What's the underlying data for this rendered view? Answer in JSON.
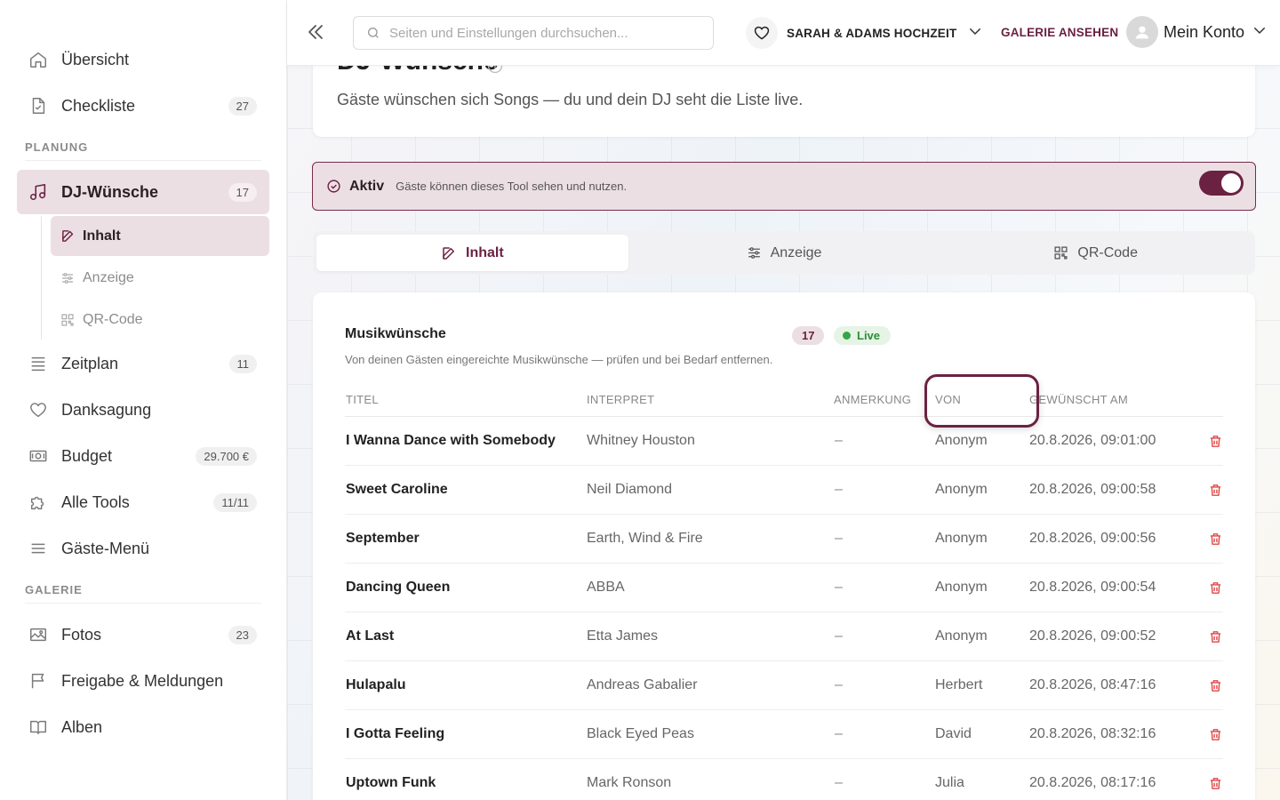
{
  "sidebar": {
    "top_items": [
      {
        "label": "Übersicht",
        "badge": ""
      },
      {
        "label": "Checkliste",
        "badge": "27"
      }
    ],
    "section_planung": "PLANUNG",
    "dj_item": {
      "label": "DJ-Wünsche",
      "badge": "17"
    },
    "dj_sub": [
      {
        "label": "Inhalt"
      },
      {
        "label": "Anzeige"
      },
      {
        "label": "QR-Code"
      }
    ],
    "planung_items": [
      {
        "label": "Zeitplan",
        "badge": "11"
      },
      {
        "label": "Danksagung",
        "badge": ""
      },
      {
        "label": "Budget",
        "badge": "29.700 €"
      },
      {
        "label": "Alle Tools",
        "badge": "11/11"
      },
      {
        "label": "Gäste-Menü",
        "badge": ""
      }
    ],
    "section_galerie": "GALERIE",
    "galerie_items": [
      {
        "label": "Fotos",
        "badge": "23"
      },
      {
        "label": "Freigabe & Meldungen",
        "badge": ""
      },
      {
        "label": "Alben",
        "badge": ""
      }
    ]
  },
  "topbar": {
    "search_placeholder": "Seiten und Einstellungen durchsuchen...",
    "event_name": "SARAH & ADAMS HOCHZEIT",
    "gallery_link": "GALERIE ANSEHEN",
    "account_label": "Mein Konto"
  },
  "header": {
    "title": "DJ-Wünsche",
    "subtitle": "Gäste wünschen sich Songs — du und dein DJ seht die Liste live."
  },
  "active_bar": {
    "label": "Aktiv",
    "hint": "Gäste können dieses Tool sehen und nutzen.",
    "toggle_on": true
  },
  "tabs": [
    {
      "label": "Inhalt",
      "active": true
    },
    {
      "label": "Anzeige",
      "active": false
    },
    {
      "label": "QR-Code",
      "active": false
    }
  ],
  "table": {
    "title": "Musikwünsche",
    "count": "17",
    "live_label": "Live",
    "description": "Von deinen Gästen eingereichte Musikwünsche — prüfen und bei Bedarf entfernen.",
    "columns": [
      "TITEL",
      "INTERPRET",
      "ANMERKUNG",
      "VON",
      "GEWÜNSCHT AM"
    ],
    "rows": [
      {
        "title": "I Wanna Dance with Somebody",
        "artist": "Whitney Houston",
        "note": "–",
        "from": "Anonym",
        "date": "20.8.2026, 09:01:00"
      },
      {
        "title": "Sweet Caroline",
        "artist": "Neil Diamond",
        "note": "–",
        "from": "Anonym",
        "date": "20.8.2026, 09:00:58"
      },
      {
        "title": "September",
        "artist": "Earth, Wind & Fire",
        "note": "–",
        "from": "Anonym",
        "date": "20.8.2026, 09:00:56"
      },
      {
        "title": "Dancing Queen",
        "artist": "ABBA",
        "note": "–",
        "from": "Anonym",
        "date": "20.8.2026, 09:00:54"
      },
      {
        "title": "At Last",
        "artist": "Etta James",
        "note": "–",
        "from": "Anonym",
        "date": "20.8.2026, 09:00:52"
      },
      {
        "title": "Hulapalu",
        "artist": "Andreas Gabalier",
        "note": "–",
        "from": "Herbert",
        "date": "20.8.2026, 08:47:16"
      },
      {
        "title": "I Gotta Feeling",
        "artist": "Black Eyed Peas",
        "note": "–",
        "from": "David",
        "date": "20.8.2026, 08:32:16"
      },
      {
        "title": "Uptown Funk",
        "artist": "Mark Ronson",
        "note": "–",
        "from": "Julia",
        "date": "20.8.2026, 08:17:16"
      }
    ]
  },
  "colors": {
    "accent": "#6b2142",
    "accent_soft": "#ecdfe3",
    "live_green": "#37a447",
    "delete_red": "#e04848"
  },
  "icons": {
    "uebersicht": "home-icon",
    "checkliste": "checklist-file-icon",
    "dj": "music-note-icon",
    "inhalt": "edit-icon",
    "anzeige": "sliders-icon",
    "qr": "qr-code-icon",
    "zeitplan": "timeline-list-icon",
    "danksagung": "heart-icon",
    "budget": "banknote-icon",
    "tools": "puzzle-icon",
    "menu": "menu-icon",
    "fotos": "image-icon",
    "freigabe": "flag-icon",
    "alben": "book-icon",
    "delete": "trash-icon"
  }
}
